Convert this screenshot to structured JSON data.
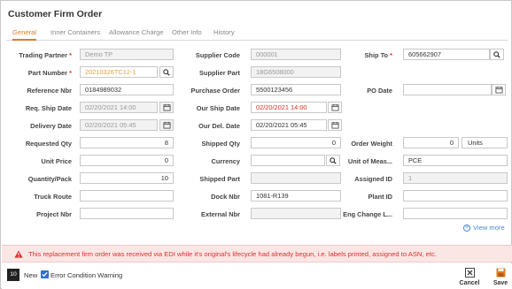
{
  "window": {
    "title": "Customer Firm Order"
  },
  "tabs": [
    "General",
    "Inner Containers",
    "Allowance Charge",
    "Other Info",
    "History"
  ],
  "form": {
    "trading_partner_label": "Trading Partner",
    "trading_partner_value": "Demo TP",
    "supplier_code_label": "Supplier Code",
    "supplier_code_value": "000001",
    "ship_to_label": "Ship To",
    "ship_to_value": "605662907",
    "part_number_label": "Part Number",
    "part_number_value": "20210326TC12-1",
    "supplier_part_label": "Supplier Part",
    "supplier_part_value": "18G6508000",
    "reference_nbr_label": "Reference Nbr",
    "reference_nbr_value": "0184989032",
    "purchase_order_label": "Purchase Order",
    "purchase_order_value": "5500123456",
    "po_date_label": "PO Date",
    "po_date_value": "",
    "req_ship_date_label": "Req. Ship Date",
    "req_ship_date_value": "02/20/2021 14:00",
    "our_ship_date_label": "Our Ship Date",
    "our_ship_date_value": "02/20/2021 14:00",
    "delivery_date_label": "Delivery Date",
    "delivery_date_value": "02/20/2021 05:45",
    "our_del_date_label": "Our Del. Date",
    "our_del_date_value": "02/20/2021 05:45",
    "requested_qty_label": "Requested Qty",
    "requested_qty_value": "8",
    "shipped_qty_label": "Shipped Qty",
    "shipped_qty_value": "0",
    "order_weight_label": "Order Weight",
    "order_weight_value": "0",
    "order_weight_unit": "Units",
    "unit_price_label": "Unit Price",
    "unit_price_value": "0",
    "currency_label": "Currency",
    "currency_value": "",
    "unit_of_measure_label": "Unit of Meas...",
    "unit_of_measure_value": "PCE",
    "quantity_pack_label": "Quantity/Pack",
    "quantity_pack_value": "10",
    "shipped_part_label": "Shipped Part",
    "shipped_part_value": "",
    "assigned_id_label": "Assigned ID",
    "assigned_id_value": "1",
    "truck_route_label": "Truck Route",
    "truck_route_value": "",
    "dock_nbr_label": "Dock Nbr",
    "dock_nbr_value": "1081-R139",
    "plant_id_label": "Plant ID",
    "plant_id_value": "",
    "project_nbr_label": "Project Nbr",
    "project_nbr_value": "",
    "external_nbr_label": "External Nbr",
    "external_nbr_value": "",
    "eng_change_label": "Eng Change L...",
    "eng_change_value": ""
  },
  "view_more": "View more",
  "error": {
    "message": "This replacement firm order was received via EDI while it's original's lifecycle had already begun, i.e. labels printed, assigned to ASN, etc."
  },
  "footer": {
    "count": "10",
    "new_label": "New",
    "warning_label": "Error Condition Warning",
    "cancel_label": "Cancel",
    "save_label": "Save"
  },
  "colors": {
    "accent": "#e07b24",
    "error": "#d9322b",
    "error_bg": "#fbe6e6",
    "link": "#4a8ad4",
    "checkbox": "#2f6fd0"
  },
  "icons": [
    "search-icon",
    "calendar-icon",
    "plus-circle-icon",
    "warning-icon",
    "checkbox-icon",
    "cancel-icon",
    "save-icon"
  ]
}
